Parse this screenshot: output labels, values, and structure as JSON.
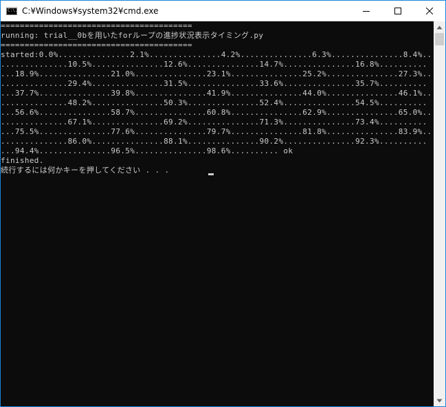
{
  "window": {
    "title": "C:¥Windows¥system32¥cmd.exe",
    "icon": "cmd-icon",
    "icon_label": "C:\\."
  },
  "controls": {
    "minimize": "minimize-icon",
    "maximize": "maximize-icon",
    "close": "close-icon"
  },
  "console": {
    "lines": [
      "========================================",
      "running: trial__0bを用いたforループの進捗状況表示タイミング.py",
      "========================================",
      "started:0.0%...............2.1%...............4.2%...............6.3%...............8.4%..",
      "..............10.5%...............12.6%...............14.7%...............16.8%..........",
      "...18.9%...............21.0%...............23.1%...............25.2%...............27.3%..",
      "..............29.4%...............31.5%...............33.6%...............35.7%..........",
      "...37.7%...............39.8%...............41.9%...............44.0%...............46.1%..",
      "..............48.2%...............50.3%...............52.4%...............54.5%..........",
      "...56.6%...............58.7%...............60.8%...............62.9%...............65.0%..",
      "..............67.1%...............69.2%...............71.3%...............73.4%..........",
      "...75.5%...............77.6%...............79.7%...............81.8%...............83.9%..",
      "..............86.0%...............88.1%...............90.2%...............92.3%..........",
      "...94.4%...............96.5%...............98.6%.......... ok",
      "finished.",
      "続行するには何かキーを押してください . . ."
    ],
    "text_color": "#cccccc",
    "background": "#0c0c0c"
  },
  "scrollbar": {
    "up": "scroll-up-arrow-icon",
    "down": "scroll-down-arrow-icon"
  },
  "colors": {
    "border": "#1883d7",
    "titlebar": "#ffffff"
  }
}
